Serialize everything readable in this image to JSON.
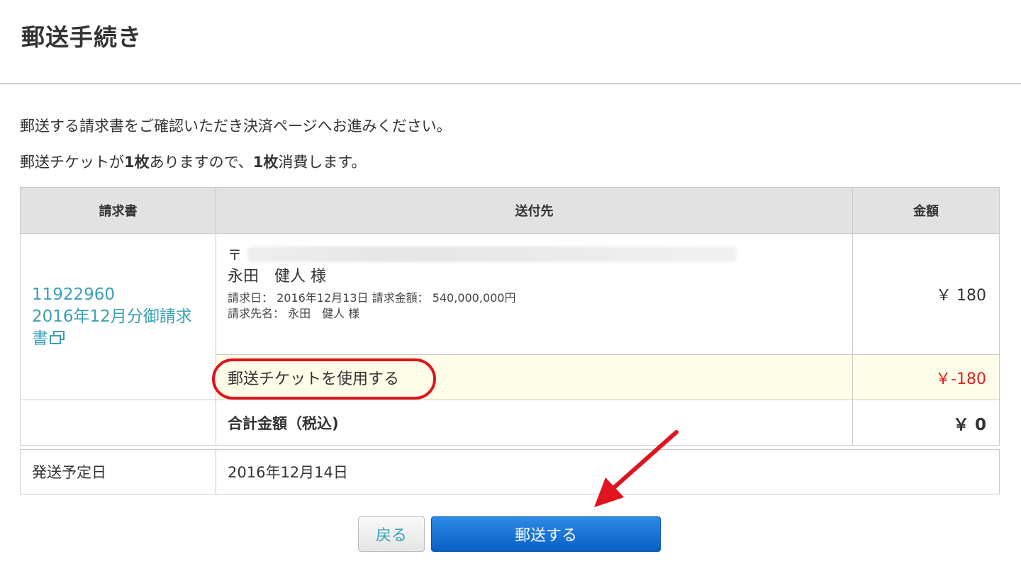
{
  "header": {
    "title": "郵送手続き"
  },
  "intro": {
    "line1": "郵送する請求書をご確認いただき決済ページへお進みください。",
    "line2_prefix": "郵送チケットが",
    "line2_count1": "1枚",
    "line2_mid": "ありますので、",
    "line2_count2": "1枚",
    "line2_suffix": "消費します。"
  },
  "table": {
    "headers": {
      "invoice": "請求書",
      "destination": "送付先",
      "amount": "金額"
    },
    "invoice": {
      "number": "11922960",
      "title": "2016年12月分御請求書"
    },
    "destination": {
      "postal_mark": "〒",
      "recipient": "永田　健人 様",
      "detail_line1": "請求日： 2016年12月13日  請求金額： 540,000,000円",
      "detail_line2": "請求先名： 永田　健人 様"
    },
    "amount": "￥ 180",
    "ticket": {
      "label": "郵送チケットを使用する",
      "amount": "￥-180"
    },
    "total": {
      "label": "合計金額（税込)",
      "amount": "￥ 0"
    }
  },
  "shipping": {
    "label": "発送予定日",
    "date": "2016年12月14日"
  },
  "buttons": {
    "back": "戻る",
    "send": "郵送する"
  },
  "colors": {
    "link": "#3a9fb5",
    "highlight": "#e0141e",
    "primary": "#0a5fc4",
    "negative": "#e0201e"
  }
}
